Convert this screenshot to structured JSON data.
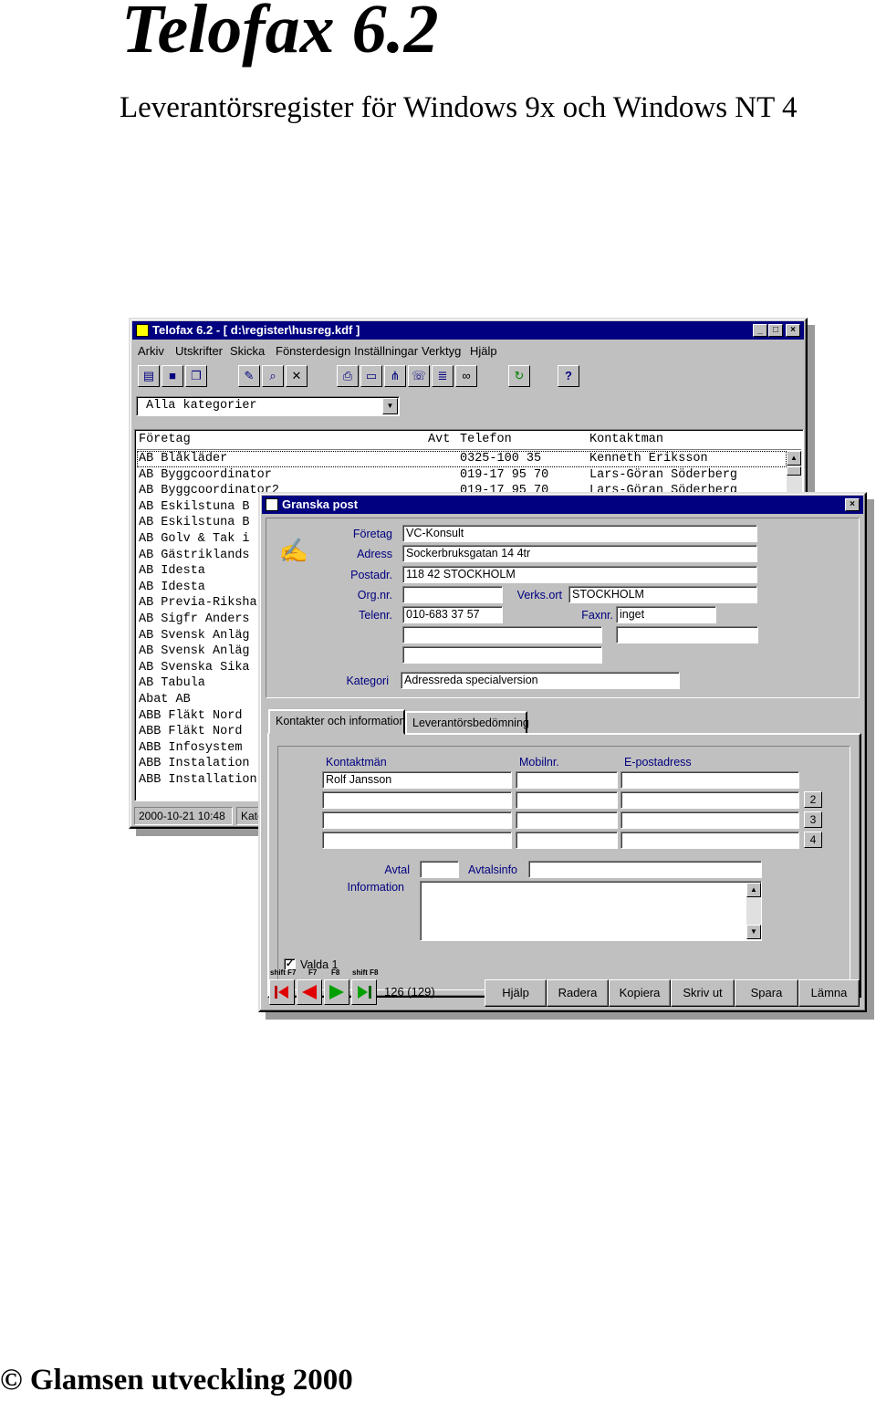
{
  "document": {
    "title": "Telofax 6.2",
    "subtitle": "Leverantörsregister för Windows 9x och Windows NT 4",
    "footer": "© Glamsen utveckling   2000"
  },
  "main_window": {
    "title": "Telofax 6.2   - [ d:\\register\\husreg.kdf ]",
    "menu": [
      "Arkiv",
      "Utskrifter",
      "Skicka",
      "Fönsterdesign",
      "Inställningar",
      "Verktyg",
      "Hjälp"
    ],
    "category": "Alla kategorier",
    "columns": {
      "company": "Företag",
      "avt": "Avt",
      "phone": "Telefon",
      "contact": "Kontaktman"
    },
    "rows": [
      {
        "company": "AB Blåkläder",
        "phone": "0325-100 35",
        "contact": "Kenneth Eriksson"
      },
      {
        "company": "AB Byggcoordinator",
        "phone": "019-17 95 70",
        "contact": "Lars-Göran Söderberg"
      },
      {
        "company": "AB Byggcoordinator2",
        "phone": "019-17 95 70",
        "contact": "Lars-Göran Söderberg"
      },
      {
        "company": "AB Eskilstuna B",
        "phone": "",
        "contact": ""
      },
      {
        "company": "AB Eskilstuna B",
        "phone": "",
        "contact": ""
      },
      {
        "company": "AB Golv & Tak i",
        "phone": "",
        "contact": ""
      },
      {
        "company": "AB Gästriklands",
        "phone": "",
        "contact": ""
      },
      {
        "company": "AB Idesta",
        "phone": "",
        "contact": ""
      },
      {
        "company": "AB Idesta",
        "phone": "",
        "contact": ""
      },
      {
        "company": "AB Previa-Riksha",
        "phone": "",
        "contact": ""
      },
      {
        "company": "AB Sigfr Anders",
        "phone": "",
        "contact": ""
      },
      {
        "company": "AB Svensk Anläg",
        "phone": "",
        "contact": ""
      },
      {
        "company": "AB Svensk Anläg",
        "phone": "",
        "contact": ""
      },
      {
        "company": "AB Svenska Sika",
        "phone": "",
        "contact": ""
      },
      {
        "company": "AB Tabula",
        "phone": "",
        "contact": ""
      },
      {
        "company": "Abat AB",
        "phone": "",
        "contact": ""
      },
      {
        "company": "ABB Fläkt Nord",
        "phone": "",
        "contact": ""
      },
      {
        "company": "ABB Fläkt Nord",
        "phone": "",
        "contact": ""
      },
      {
        "company": "ABB Infosystem",
        "phone": "",
        "contact": ""
      },
      {
        "company": "ABB Instalation",
        "phone": "",
        "contact": ""
      },
      {
        "company": "ABB Installation",
        "phone": "",
        "contact": ""
      }
    ],
    "status": {
      "datetime": "2000-10-21  10:48",
      "category": "Kate"
    }
  },
  "dialog": {
    "title": "Granska post",
    "fields": {
      "company_label": "Företag",
      "company": "VC-Konsult",
      "address_label": "Adress",
      "address": "Sockerbruksgatan 14 4tr",
      "postal_label": "Postadr.",
      "postal": "118 42 STOCKHOLM",
      "orgnr_label": "Org.nr.",
      "orgnr": "",
      "verksort_label": "Verks.ort",
      "verksort": "STOCKHOLM",
      "phone_label": "Telenr.",
      "phone": "010-683 37 57",
      "fax_label": "Faxnr.",
      "fax": "inget",
      "category_label": "Kategori",
      "category": "Adressreda specialversion"
    },
    "tabs": [
      "Kontakter och information",
      "Leverantörsbedömning"
    ],
    "contacts": {
      "headers": [
        "Kontaktmän",
        "Mobilnr.",
        "E-postadress"
      ],
      "rows": [
        [
          "Rolf Jansson",
          "",
          ""
        ],
        [
          "",
          "",
          ""
        ],
        [
          "",
          "",
          ""
        ],
        [
          "",
          "",
          ""
        ]
      ],
      "page_buttons": [
        "2",
        "3",
        "4"
      ]
    },
    "agreement_label": "Avtal",
    "agreement": "",
    "agreement_info_label": "Avtalsinfo",
    "agreement_info": "",
    "information_label": "Information",
    "information": "",
    "selected_label": "Valda 1",
    "fkeys": [
      "shift F7",
      "F7",
      "F8",
      "shift F8"
    ],
    "record_counter": "126 (129)",
    "buttons": [
      "Hjälp",
      "Radera",
      "Kopiera",
      "Skriv ut",
      "Spara",
      "Lämna"
    ]
  }
}
